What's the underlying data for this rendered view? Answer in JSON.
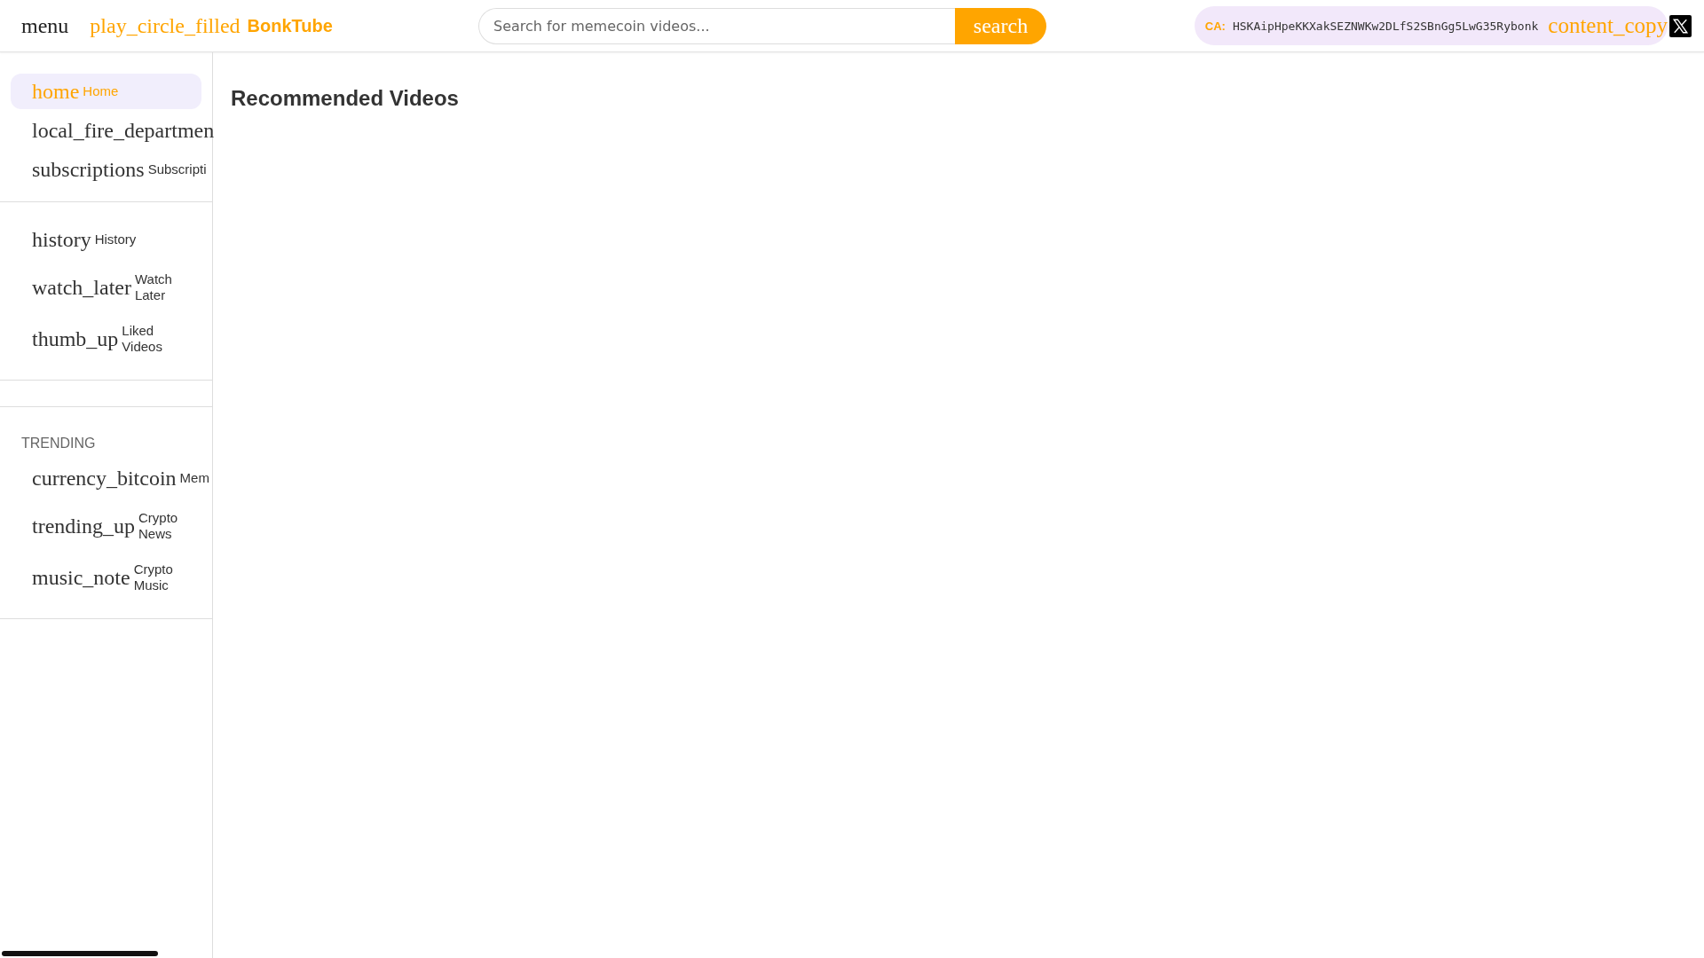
{
  "header": {
    "menu_icon": "menu",
    "logo_icon": "play_circle_filled",
    "logo_text": "BonkTube",
    "search": {
      "placeholder": "Search for memecoin videos..."
    },
    "search_button": "search",
    "contract": {
      "label": "CA:",
      "address": "HSKAipHpeKKXakSEZNWKw2DLfS2SBnGg5LwG35Rybonk",
      "copy_icon": "content_copy"
    }
  },
  "sidebar": {
    "sections": [
      {
        "items": [
          {
            "icon": "home",
            "label": "Home",
            "selected": true
          },
          {
            "icon": "local_fire_departmen",
            "selected": false
          },
          {
            "icon": "subscriptions",
            "label": "Subscripti",
            "selected": false
          }
        ]
      },
      {
        "items": [
          {
            "icon": "history",
            "label": "History",
            "selected": false
          },
          {
            "icon": "watch_later",
            "label": "Watch Later",
            "selected": false
          },
          {
            "icon": "thumb_up",
            "label": "Liked Videos",
            "selected": false
          }
        ]
      },
      {
        "title": "TRENDING",
        "items": [
          {
            "icon": "currency_bitcoin",
            "label": "Mem",
            "selected": false
          },
          {
            "icon": "trending_up",
            "label": "Crypto News",
            "selected": false
          },
          {
            "icon": "music_note",
            "label": "Crypto Music",
            "selected": false
          }
        ]
      }
    ]
  },
  "main": {
    "title": "Recommended Videos"
  }
}
